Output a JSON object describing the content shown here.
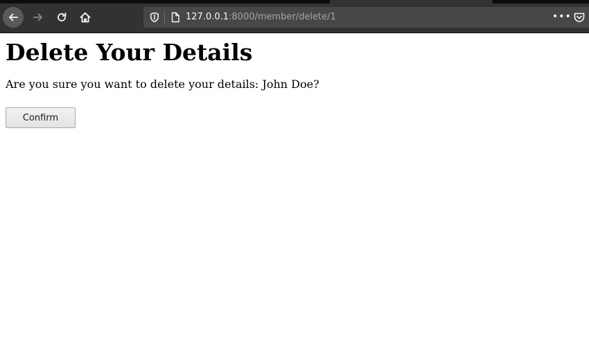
{
  "browser": {
    "url_host": "127.0.0.1",
    "url_path": ":8000/member/delete/1",
    "page_actions_label": "•••",
    "icons": {
      "back": "back-arrow-icon",
      "forward": "forward-arrow-icon",
      "reload": "reload-icon",
      "home": "home-icon",
      "tracking": "shield-icon",
      "page": "page-icon",
      "pocket": "pocket-icon"
    },
    "colors": {
      "toolbar": "#323234",
      "urlbar": "#474749"
    }
  },
  "page": {
    "title": "Delete Your Details",
    "message": "Are you sure you want to delete your details: John Doe?",
    "confirm_label": "Confirm"
  }
}
